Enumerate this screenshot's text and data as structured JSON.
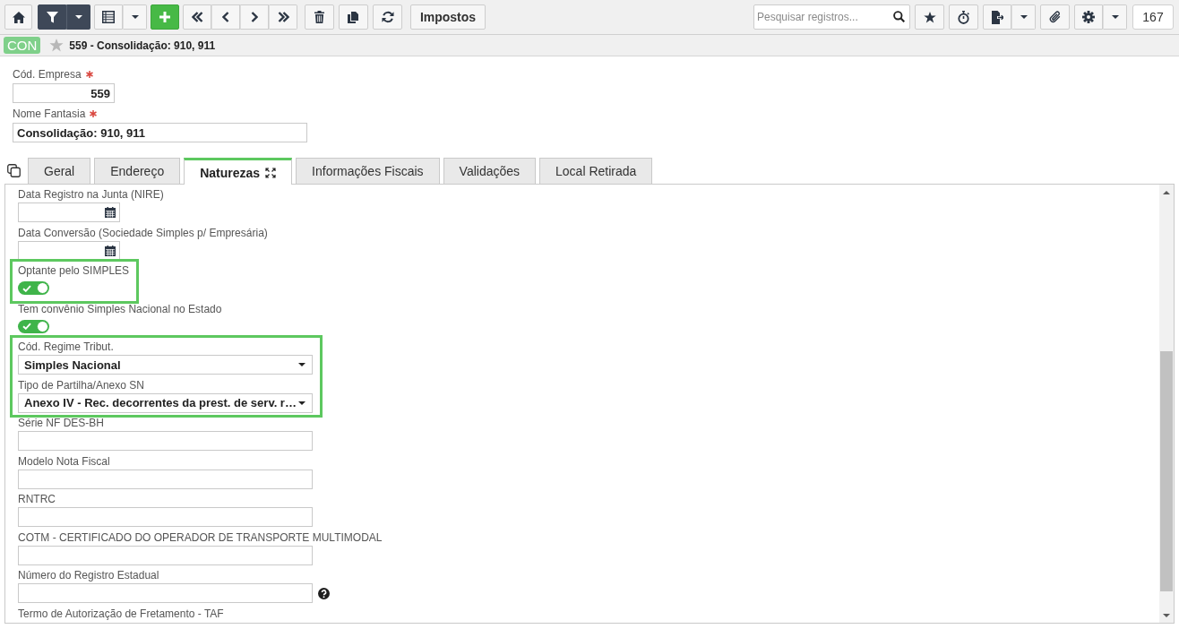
{
  "toolbar": {
    "filter_active": true,
    "action_button": "Impostos",
    "search": {
      "placeholder": "Pesquisar registros..."
    },
    "record_count": "167"
  },
  "header": {
    "badge": "CON",
    "favorite": false,
    "title": "559 - Consolidação: 910, 911"
  },
  "form": {
    "fields": [
      {
        "kind": "number",
        "label": "Cód. Empresa",
        "required": true,
        "value": "559"
      },
      {
        "kind": "text",
        "label": "Nome Fantasia",
        "required": true,
        "value": "Consolidação: 910, 911"
      }
    ]
  },
  "tabs": [
    {
      "label": "Geral",
      "selected": false
    },
    {
      "label": "Endereço",
      "selected": false
    },
    {
      "label": "Naturezas",
      "selected": true
    },
    {
      "label": "Informações Fiscais",
      "selected": false
    },
    {
      "label": "Validações",
      "selected": false
    },
    {
      "label": "Local Retirada",
      "selected": false
    }
  ],
  "tab_panel": {
    "fields": [
      {
        "kind": "date",
        "label": "Data Registro na Junta (NIRE)",
        "highlighted": false,
        "help": false
      },
      {
        "kind": "date",
        "label": "Data Conversão (Sociedade Simples p/ Empresária)",
        "highlighted": false,
        "help": false
      },
      {
        "kind": "toggle",
        "label": "Optante pelo SIMPLES",
        "on": true,
        "highlighted": true,
        "help": false
      },
      {
        "kind": "toggle",
        "label": "Tem convênio Simples Nacional no Estado",
        "on": true,
        "highlighted": false,
        "help": false
      },
      {
        "kind": "select",
        "label": "Cód. Regime Tribut.",
        "value": "Simples Nacional",
        "highlighted": true,
        "help": false
      },
      {
        "kind": "select",
        "label": "Tipo de Partilha/Anexo SN",
        "value": "Anexo IV - Rec. decorrentes da prest. de serv. r…",
        "highlighted": true,
        "help": false
      },
      {
        "kind": "text",
        "label": "Série NF DES-BH",
        "highlighted": false,
        "help": false
      },
      {
        "kind": "text",
        "label": "Modelo Nota Fiscal",
        "highlighted": false,
        "help": false
      },
      {
        "kind": "text",
        "label": "RNTRC",
        "highlighted": false,
        "help": false
      },
      {
        "kind": "text",
        "label": "COTM - CERTIFICADO DO OPERADOR DE TRANSPORTE MULTIMODAL",
        "highlighted": false,
        "help": false
      },
      {
        "kind": "text",
        "label": "Número do Registro Estadual",
        "highlighted": false,
        "help": true
      },
      {
        "kind": "label",
        "label": "Termo de Autorização de Fretamento - TAF",
        "highlighted": false,
        "help": false
      }
    ]
  }
}
